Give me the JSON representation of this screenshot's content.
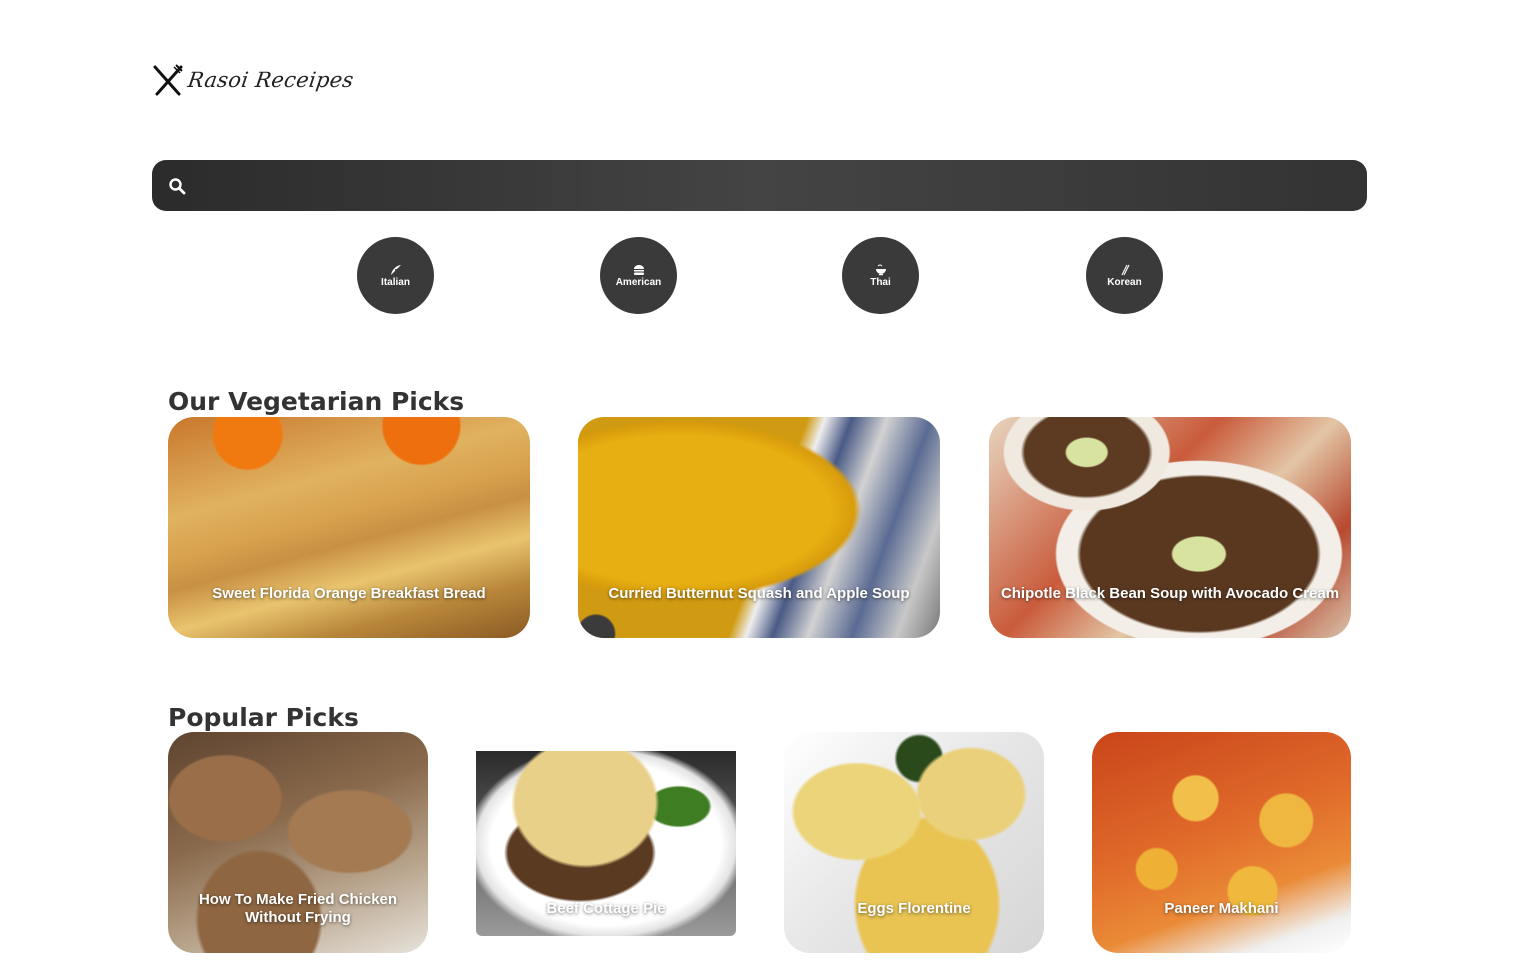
{
  "logo": {
    "text": "Rasoi Receipes",
    "icon": "fork-knife-icon"
  },
  "search": {
    "placeholder": "",
    "value": "",
    "icon": "search-icon"
  },
  "cuisines": [
    {
      "label": "Italian",
      "icon": "pizza-icon"
    },
    {
      "label": "American",
      "icon": "burger-icon"
    },
    {
      "label": "Thai",
      "icon": "bowl-icon"
    },
    {
      "label": "Korean",
      "icon": "chopsticks-icon"
    }
  ],
  "vegetarian": {
    "title": "Our Vegetarian Picks",
    "items": [
      {
        "title": "Sweet Florida Orange Breakfast Bread"
      },
      {
        "title": "Curried Butternut Squash and Apple Soup"
      },
      {
        "title": "Chipotle Black Bean Soup with Avocado Cream"
      }
    ]
  },
  "popular": {
    "title": "Popular Picks",
    "items": [
      {
        "title": "How To Make Fried Chicken Without Frying"
      },
      {
        "title": "Beef Cottage Pie"
      },
      {
        "title": "Eggs Florentine"
      },
      {
        "title": "Paneer Makhani"
      }
    ]
  },
  "colors": {
    "search_bg": "#333333",
    "cuisine_bg": "#3a3a3a",
    "heading": "#333333"
  }
}
